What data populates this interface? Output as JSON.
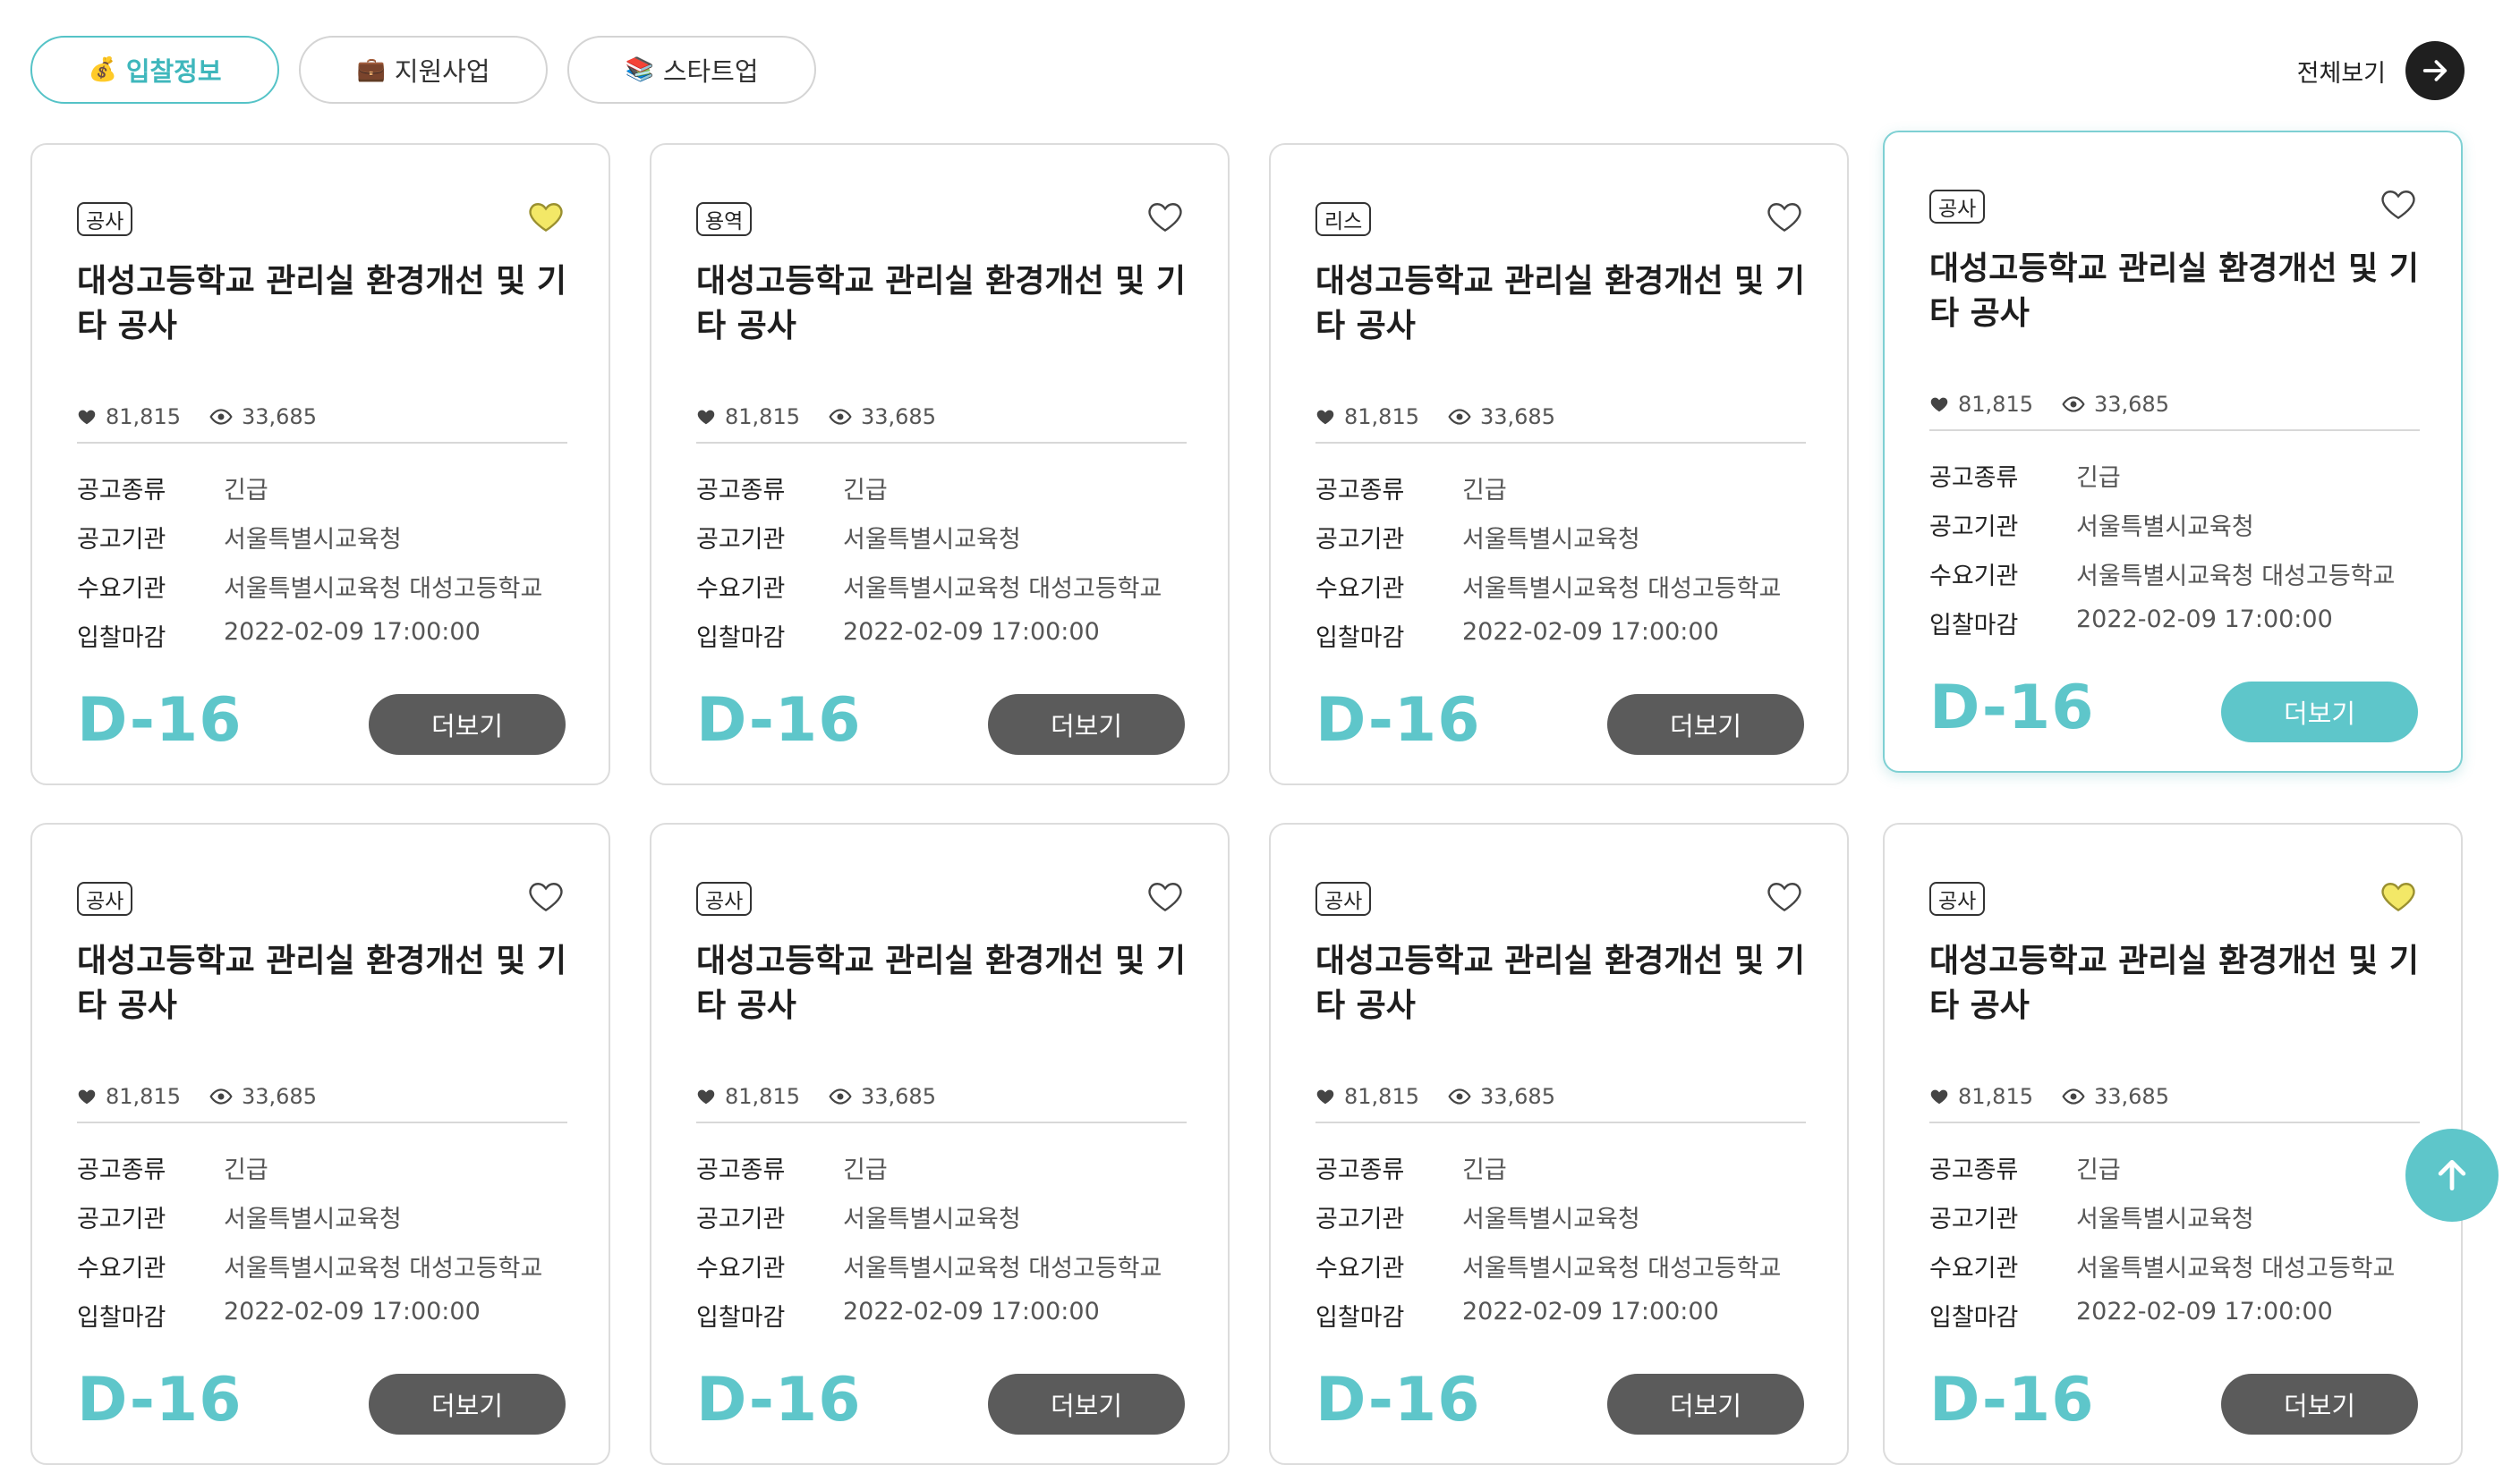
{
  "tabs": [
    {
      "emoji": "💰",
      "label": "입찰정보",
      "active": true
    },
    {
      "emoji": "💼",
      "label": "지원사업",
      "active": false
    },
    {
      "emoji": "📚",
      "label": "스타트업",
      "active": false
    }
  ],
  "view_all": {
    "label": "전체보기"
  },
  "colors": {
    "accent": "#5ec6ca",
    "button_dark": "#5b5b5b",
    "heart_active": "#f3e867"
  },
  "fields": {
    "type": "공고종류",
    "agency": "공고기관",
    "demand": "수요기관",
    "deadline": "입찰마감"
  },
  "more_label": "더보기",
  "cards": [
    {
      "badge": "공사",
      "liked": true,
      "title": "대성고등학교 관리실 환경개선 및 기타 공사",
      "likes": "81,815",
      "views": "33,685",
      "type": "긴급",
      "agency": "서울특별시교육청",
      "demand": "서울특별시교육청 대성고등학교",
      "deadline": "2022-02-09 17:00:00",
      "dday": "D-16",
      "active": false
    },
    {
      "badge": "용역",
      "liked": false,
      "title": "대성고등학교 관리실 환경개선 및 기타 공사",
      "likes": "81,815",
      "views": "33,685",
      "type": "긴급",
      "agency": "서울특별시교육청",
      "demand": "서울특별시교육청 대성고등학교",
      "deadline": "2022-02-09 17:00:00",
      "dday": "D-16",
      "active": false
    },
    {
      "badge": "리스",
      "liked": false,
      "title": "대성고등학교 관리실 환경개선 및 기타 공사",
      "likes": "81,815",
      "views": "33,685",
      "type": "긴급",
      "agency": "서울특별시교육청",
      "demand": "서울특별시교육청 대성고등학교",
      "deadline": "2022-02-09 17:00:00",
      "dday": "D-16",
      "active": false
    },
    {
      "badge": "공사",
      "liked": false,
      "title": "대성고등학교 관리실 환경개선 및 기타 공사",
      "likes": "81,815",
      "views": "33,685",
      "type": "긴급",
      "agency": "서울특별시교육청",
      "demand": "서울특별시교육청 대성고등학교",
      "deadline": "2022-02-09 17:00:00",
      "dday": "D-16",
      "active": true
    },
    {
      "badge": "공사",
      "liked": false,
      "title": "대성고등학교 관리실 환경개선 및 기타 공사",
      "likes": "81,815",
      "views": "33,685",
      "type": "긴급",
      "agency": "서울특별시교육청",
      "demand": "서울특별시교육청 대성고등학교",
      "deadline": "2022-02-09 17:00:00",
      "dday": "D-16",
      "active": false
    },
    {
      "badge": "공사",
      "liked": false,
      "title": "대성고등학교 관리실 환경개선 및 기타 공사",
      "likes": "81,815",
      "views": "33,685",
      "type": "긴급",
      "agency": "서울특별시교육청",
      "demand": "서울특별시교육청 대성고등학교",
      "deadline": "2022-02-09 17:00:00",
      "dday": "D-16",
      "active": false
    },
    {
      "badge": "공사",
      "liked": false,
      "title": "대성고등학교 관리실 환경개선 및 기타 공사",
      "likes": "81,815",
      "views": "33,685",
      "type": "긴급",
      "agency": "서울특별시교육청",
      "demand": "서울특별시교육청 대성고등학교",
      "deadline": "2022-02-09 17:00:00",
      "dday": "D-16",
      "active": false
    },
    {
      "badge": "공사",
      "liked": true,
      "title": "대성고등학교 관리실 환경개선 및 기타 공사",
      "likes": "81,815",
      "views": "33,685",
      "type": "긴급",
      "agency": "서울특별시교육청",
      "demand": "서울특별시교육청 대성고등학교",
      "deadline": "2022-02-09 17:00:00",
      "dday": "D-16",
      "active": false
    }
  ]
}
